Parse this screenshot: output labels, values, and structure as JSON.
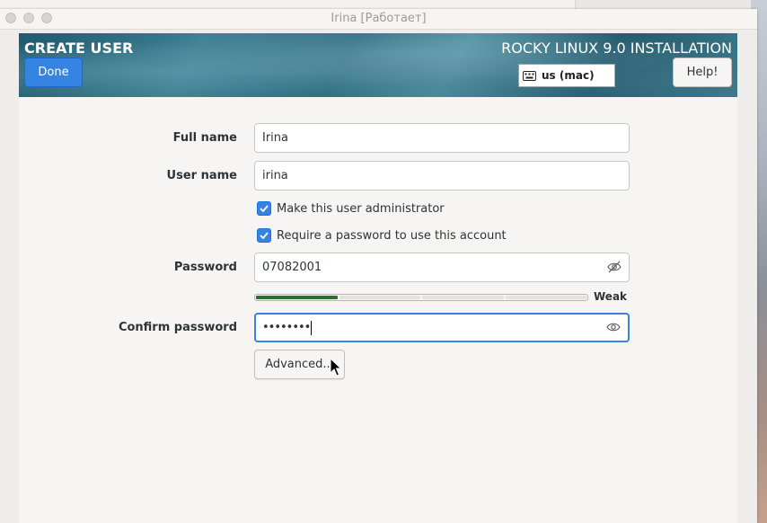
{
  "window": {
    "title": "Irina [Работает]"
  },
  "header": {
    "title": "CREATE USER",
    "done_label": "Done",
    "installation_title": "ROCKY LINUX 9.0 INSTALLATION",
    "keyboard_layout": "us (mac)",
    "help_label": "Help!"
  },
  "form": {
    "full_name_label": "Full name",
    "full_name_value": "Irina",
    "user_name_label": "User name",
    "user_name_value": "irina",
    "admin_checkbox_label": "Make this user administrator",
    "admin_checked": true,
    "require_password_label": "Require a password to use this account",
    "require_password_checked": true,
    "password_label": "Password",
    "password_value": "07082001",
    "password_strength_level": 0.25,
    "password_strength_text": "Weak",
    "confirm_password_label": "Confirm password",
    "confirm_password_value": "••••••••",
    "advanced_label": "Advanced..."
  },
  "colors": {
    "accent": "#3584e4",
    "strength_fill": "#26712c"
  },
  "icons": [
    "keyboard-icon",
    "eye-slash-icon",
    "eye-icon",
    "checkmark-icon",
    "mouse-cursor-icon"
  ]
}
